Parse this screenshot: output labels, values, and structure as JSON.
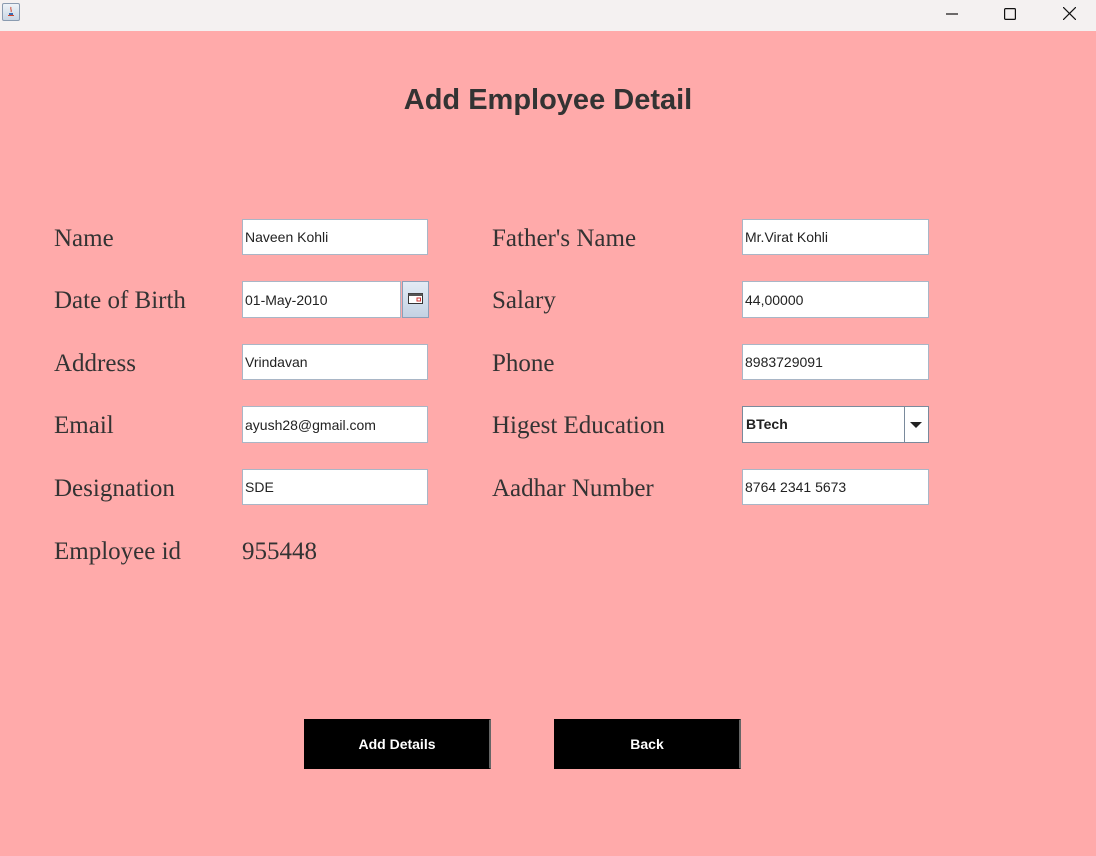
{
  "window": {
    "minimize_icon": "minimize-icon",
    "maximize_icon": "maximize-icon",
    "close_icon": "close-icon"
  },
  "form": {
    "title": "Add Employee Detail",
    "name": {
      "label": "Name",
      "value": "Naveen Kohli"
    },
    "fathers_name": {
      "label": "Father's Name",
      "value": "Mr.Virat Kohli"
    },
    "dob": {
      "label": "Date of Birth",
      "value": "01-May-2010"
    },
    "salary": {
      "label": "Salary",
      "value": "44,00000"
    },
    "address": {
      "label": "Address",
      "value": "Vrindavan"
    },
    "phone": {
      "label": "Phone",
      "value": "8983729091"
    },
    "email": {
      "label": "Email",
      "value": "ayush28@gmail.com"
    },
    "education": {
      "label": "Higest Education",
      "selected": "BTech"
    },
    "designation": {
      "label": "Designation",
      "value": "SDE"
    },
    "aadhar": {
      "label": "Aadhar Number",
      "value": "8764 2341 5673"
    },
    "employee_id": {
      "label": "Employee id",
      "value": "955448"
    }
  },
  "buttons": {
    "add_details": "Add Details",
    "back": "Back"
  },
  "colors": {
    "background": "#ffaaaa",
    "button_bg": "#000000",
    "button_text": "#ffffff"
  }
}
